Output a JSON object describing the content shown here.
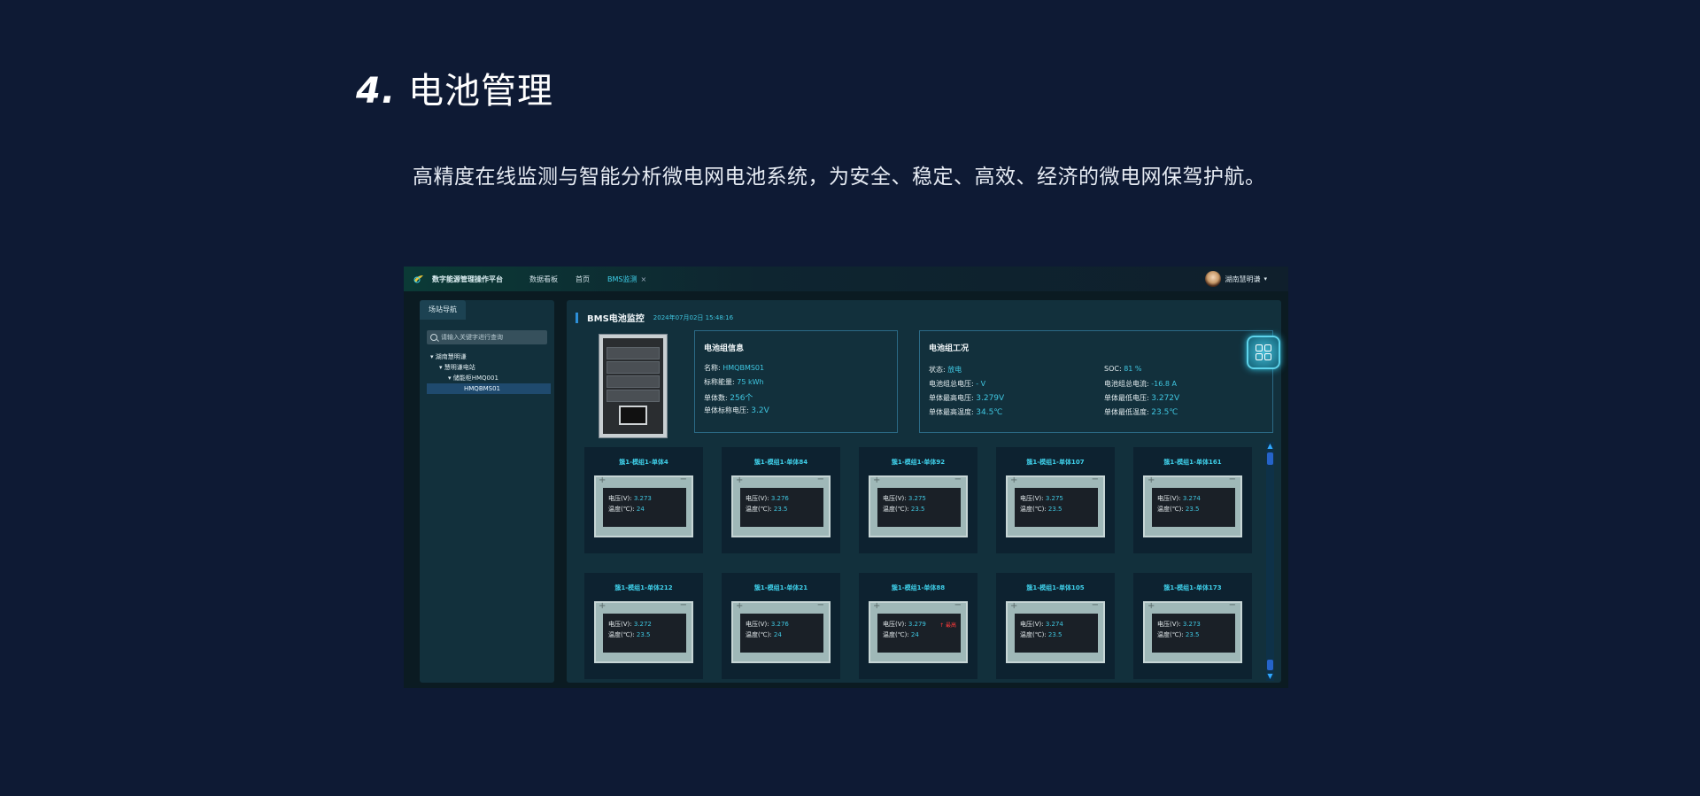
{
  "slide": {
    "number": "4.",
    "title": "电池管理",
    "description": "高精度在线监测与智能分析微电网电池系统，为安全、稳定、高效、经济的微电网保驾护航。"
  },
  "app": {
    "brand": "数字能源管理操作平台",
    "nav": [
      {
        "label": "数据看板"
      },
      {
        "label": "首页"
      },
      {
        "label": "BMS监测",
        "close": "×"
      }
    ],
    "user": "湖南慧明谦"
  },
  "sidebar": {
    "tab": "场站导航",
    "search_placeholder": "请输入关键字进行查询",
    "tree": [
      {
        "label": "▾ 湖南慧明谦",
        "indent": 0
      },
      {
        "label": "▾ 慧明谦电站",
        "indent": 1
      },
      {
        "label": "▾ 储能柜HMQ001",
        "indent": 2
      },
      {
        "label": "HMQBMS01",
        "indent": 3
      }
    ]
  },
  "main": {
    "title": "BMS电池监控",
    "datetime": "2024年07月02日 15:48:16",
    "info": {
      "title": "电池组信息",
      "name_label": "名称:",
      "name": "HMQBMS01",
      "energy_label": "标称能量:",
      "energy": "75 kWh",
      "cells_label": "单体数:",
      "cells": "256个",
      "voltage_label": "单体标称电压:",
      "voltage": "3.2V"
    },
    "status": {
      "title": "电池组工况",
      "state_label": "状态:",
      "state": "放电",
      "soc_label": "SOC:",
      "soc": "81 %",
      "total_v_label": "电池组总电压:",
      "total_v": "- V",
      "total_a_label": "电池组总电流:",
      "total_a": "-16.8 A",
      "max_v_label": "单体最高电压:",
      "max_v": "3.279V",
      "min_v_label": "单体最低电压:",
      "min_v": "3.272V",
      "max_t_label": "单体最高温度:",
      "max_t": "34.5℃",
      "min_t_label": "单体最低温度:",
      "min_t": "23.5℃"
    },
    "cells": [
      {
        "name": "簇1-模组1-单体4",
        "v": "3.273",
        "t": "24"
      },
      {
        "name": "簇1-模组1-单体84",
        "v": "3.276",
        "t": "23.5"
      },
      {
        "name": "簇1-模组1-单体92",
        "v": "3.275",
        "t": "23.5"
      },
      {
        "name": "簇1-模组1-单体107",
        "v": "3.275",
        "t": "23.5"
      },
      {
        "name": "簇1-模组1-单体161",
        "v": "3.274",
        "t": "23.5"
      },
      {
        "name": "簇1-模组1-单体212",
        "v": "3.272",
        "t": "23.5"
      },
      {
        "name": "簇1-模组1-单体21",
        "v": "3.276",
        "t": "24"
      },
      {
        "name": "簇1-模组1-单体88",
        "v": "3.279",
        "t": "24",
        "warn": "↑ 最高"
      },
      {
        "name": "簇1-模组1-单体105",
        "v": "3.274",
        "t": "23.5"
      },
      {
        "name": "簇1-模组1-单体173",
        "v": "3.273",
        "t": "23.5"
      }
    ],
    "cell_v_label": "电压(V):",
    "cell_t_label": "温度(℃):"
  }
}
